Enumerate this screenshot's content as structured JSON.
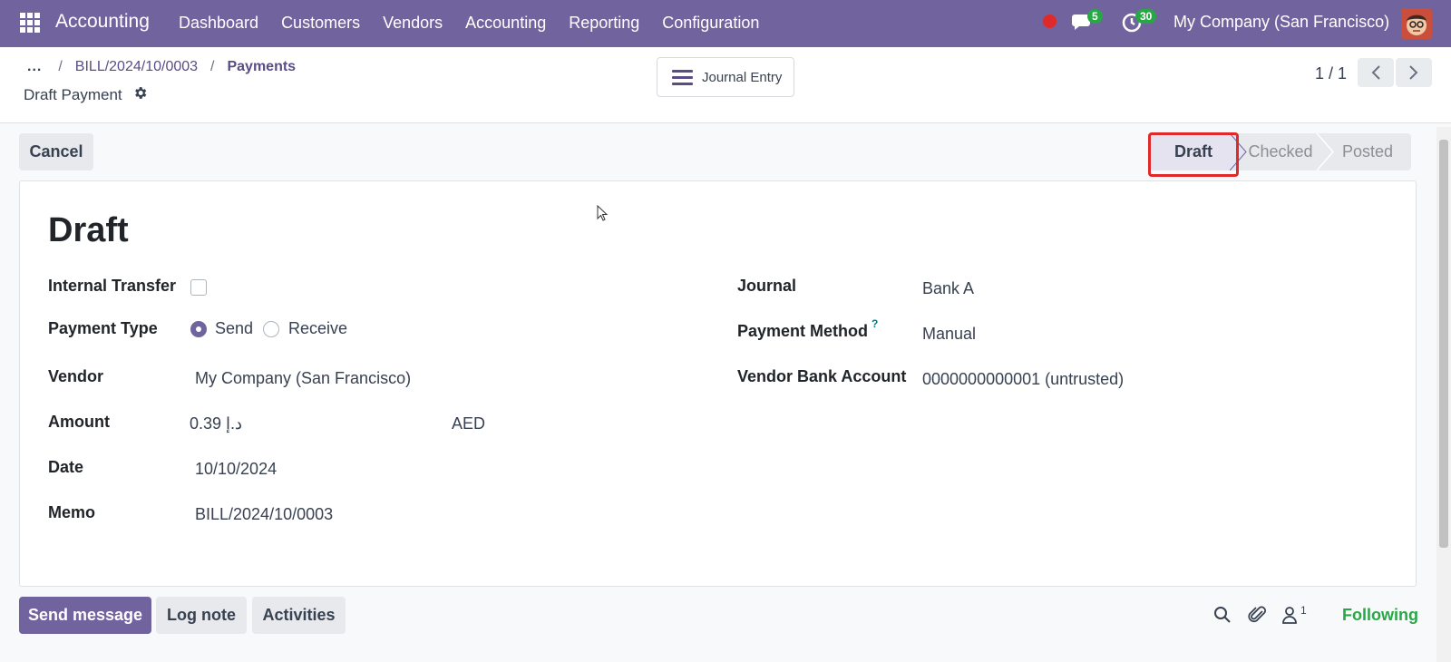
{
  "navbar": {
    "brand": "Accounting",
    "menu": [
      "Dashboard",
      "Customers",
      "Vendors",
      "Accounting",
      "Reporting",
      "Configuration"
    ],
    "messages_count": "5",
    "activities_count": "30",
    "company": "My Company (San Francisco)"
  },
  "breadcrumb": {
    "dots": "...",
    "items": [
      "BILL/2024/10/0003",
      "Payments"
    ],
    "separator": "/"
  },
  "record": {
    "name": "Draft Payment",
    "journal_entry_button": "Journal Entry",
    "pager": "1 / 1"
  },
  "status": {
    "cancel_label": "Cancel",
    "stages": [
      "Draft",
      "Checked",
      "Posted"
    ],
    "active": "Draft"
  },
  "form": {
    "title": "Draft",
    "internal_transfer_label": "Internal Transfer",
    "internal_transfer_checked": false,
    "payment_type_label": "Payment Type",
    "payment_type_options": [
      "Send",
      "Receive"
    ],
    "payment_type_value": "Send",
    "vendor_label": "Vendor",
    "vendor_value": "My Company (San Francisco)",
    "amount_label": "Amount",
    "amount_value": "د.إ 0.39",
    "currency_value": "AED",
    "date_label": "Date",
    "date_value": "10/10/2024",
    "memo_label": "Memo",
    "memo_value": "BILL/2024/10/0003",
    "journal_label": "Journal",
    "journal_value": "Bank A",
    "payment_method_label": "Payment Method",
    "payment_method_help": "?",
    "payment_method_value": "Manual",
    "vendor_bank_label": "Vendor Bank Account",
    "vendor_bank_value": "0000000000001 (untrusted)"
  },
  "chatter": {
    "send_message": "Send message",
    "log_note": "Log note",
    "activities": "Activities",
    "followers_count": "1",
    "following": "Following"
  },
  "colors": {
    "brand": "#71639e",
    "highlight": "#e02a2a",
    "following": "#28a745"
  }
}
